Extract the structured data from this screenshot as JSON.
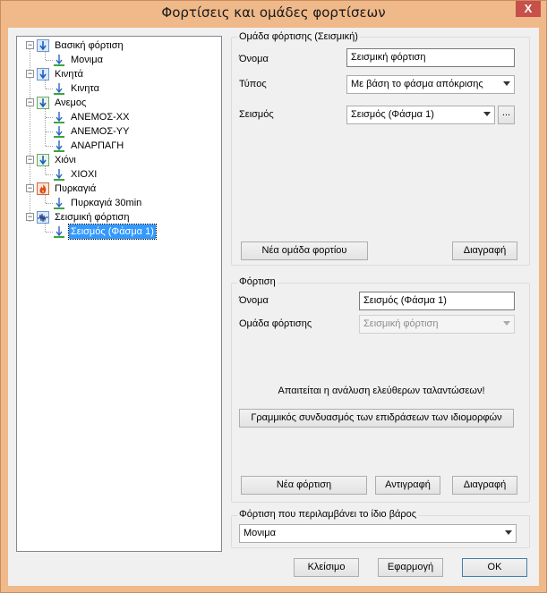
{
  "window": {
    "title": "Φορτίσεις και ομάδες φορτίσεων",
    "close_glyph": "X"
  },
  "colors": {
    "accent": "#3399ff",
    "title_bar": "#f0b98a",
    "close": "#c7504a"
  },
  "tree": {
    "items": [
      {
        "label": "Βασική φόρτιση",
        "level": 0,
        "icon": "down-arrow-icon"
      },
      {
        "label": "Μονιμα",
        "level": 1,
        "icon": "load-arrow-icon"
      },
      {
        "label": "Κινητά",
        "level": 0,
        "icon": "down-arrow-icon"
      },
      {
        "label": "Κινητα",
        "level": 1,
        "icon": "load-arrow-icon"
      },
      {
        "label": "Ανεμος",
        "level": 0,
        "icon": "down-arrow-icon"
      },
      {
        "label": "ΑΝΕΜΟΣ-ΧΧ",
        "level": 1,
        "icon": "load-arrow-icon"
      },
      {
        "label": "ΑΝΕΜΟΣ-ΥΥ",
        "level": 1,
        "icon": "load-arrow-icon"
      },
      {
        "label": "ΑΝΑΡΠΑΓΗ",
        "level": 1,
        "icon": "load-arrow-icon"
      },
      {
        "label": "Χιόνι",
        "level": 0,
        "icon": "down-arrow-icon"
      },
      {
        "label": "ΧΙΟΧΙ",
        "level": 1,
        "icon": "load-arrow-icon"
      },
      {
        "label": "Πυρκαγιά",
        "level": 0,
        "icon": "fire-icon"
      },
      {
        "label": "Πυρκαγιά 30min",
        "level": 1,
        "icon": "load-arrow-icon"
      },
      {
        "label": "Σεισμική φόρτιση",
        "level": 0,
        "icon": "seismic-icon"
      },
      {
        "label": "Σεισμός (Φάσμα 1)",
        "level": 1,
        "icon": "load-arrow-icon",
        "selected": true
      }
    ]
  },
  "load_group": {
    "caption": "Ομάδα φόρτισης (Σεισμική)",
    "name_label": "Όνομα",
    "name_value": "Σεισμική φόρτιση",
    "type_label": "Τύπος",
    "type_value": "Με βάση το φάσμα απόκρισης",
    "seismic_label": "Σεισμός",
    "seismic_value": "Σεισμός (Φάσμα 1)",
    "browse_label": "...",
    "new_group_button": "Νέα ομάδα φορτίου",
    "delete_button": "Διαγραφή"
  },
  "load": {
    "caption": "Φόρτιση",
    "name_label": "Όνομα",
    "name_value": "Σεισμός (Φάσμα 1)",
    "group_label": "Ομάδα φόρτισης",
    "group_value": "Σεισμική φόρτιση",
    "notice": "Απαιτείται η ανάλυση ελεύθερων ταλαντώσεων!",
    "combination_button": "Γραμμικός συνδυασμός των επιδράσεων των ιδιομορφών",
    "new_button": "Νέα φόρτιση",
    "copy_button": "Αντιγραφή",
    "delete_button": "Διαγραφή"
  },
  "self_weight": {
    "caption": "Φόρτιση που περιλαμβάνει το ίδιο βάρος",
    "value": "Μονιμα"
  },
  "footer": {
    "close_button": "Κλείσιμο",
    "apply_button": "Εφαρμογή",
    "ok_button": "OK"
  }
}
